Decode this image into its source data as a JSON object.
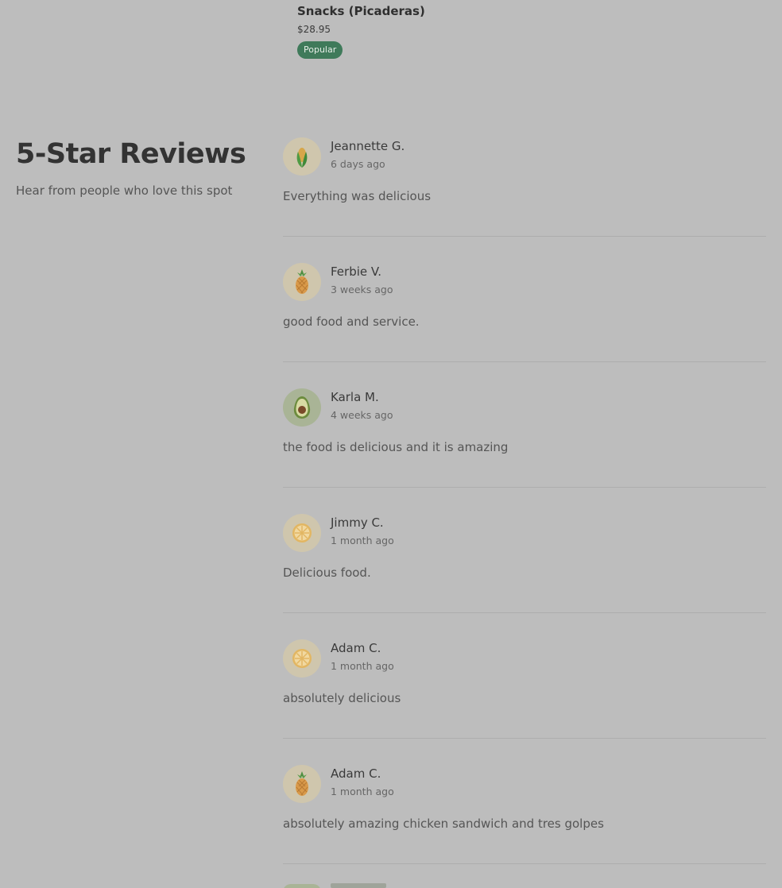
{
  "product": {
    "name": "Snacks (Picaderas)",
    "price": "$28.95",
    "badge": "Popular"
  },
  "section": {
    "title": "5-Star Reviews",
    "subtitle": "Hear from people who love this spot"
  },
  "reviews": [
    {
      "name": "Jeannette G.",
      "date": "6 days ago",
      "text": "Everything was delicious",
      "avatar": "corn-icon"
    },
    {
      "name": "Ferbie V.",
      "date": "3 weeks ago",
      "text": "good food and service.",
      "avatar": "pineapple-icon"
    },
    {
      "name": "Karla M.",
      "date": "4 weeks ago",
      "text": "the food is delicious and it is amazing",
      "avatar": "avocado-icon"
    },
    {
      "name": "Jimmy C.",
      "date": "1 month ago",
      "text": "Delicious food.",
      "avatar": "citrus-slice-icon"
    },
    {
      "name": "Adam C.",
      "date": "1 month ago",
      "text": "absolutely delicious",
      "avatar": "citrus-slice-icon"
    },
    {
      "name": "Adam C.",
      "date": "1 month ago",
      "text": "absolutely amazing chicken sandwich and tres golpes",
      "avatar": "pineapple-icon"
    }
  ],
  "colors": {
    "background": "#bdbdbd",
    "badge": "#3f7a5a"
  }
}
